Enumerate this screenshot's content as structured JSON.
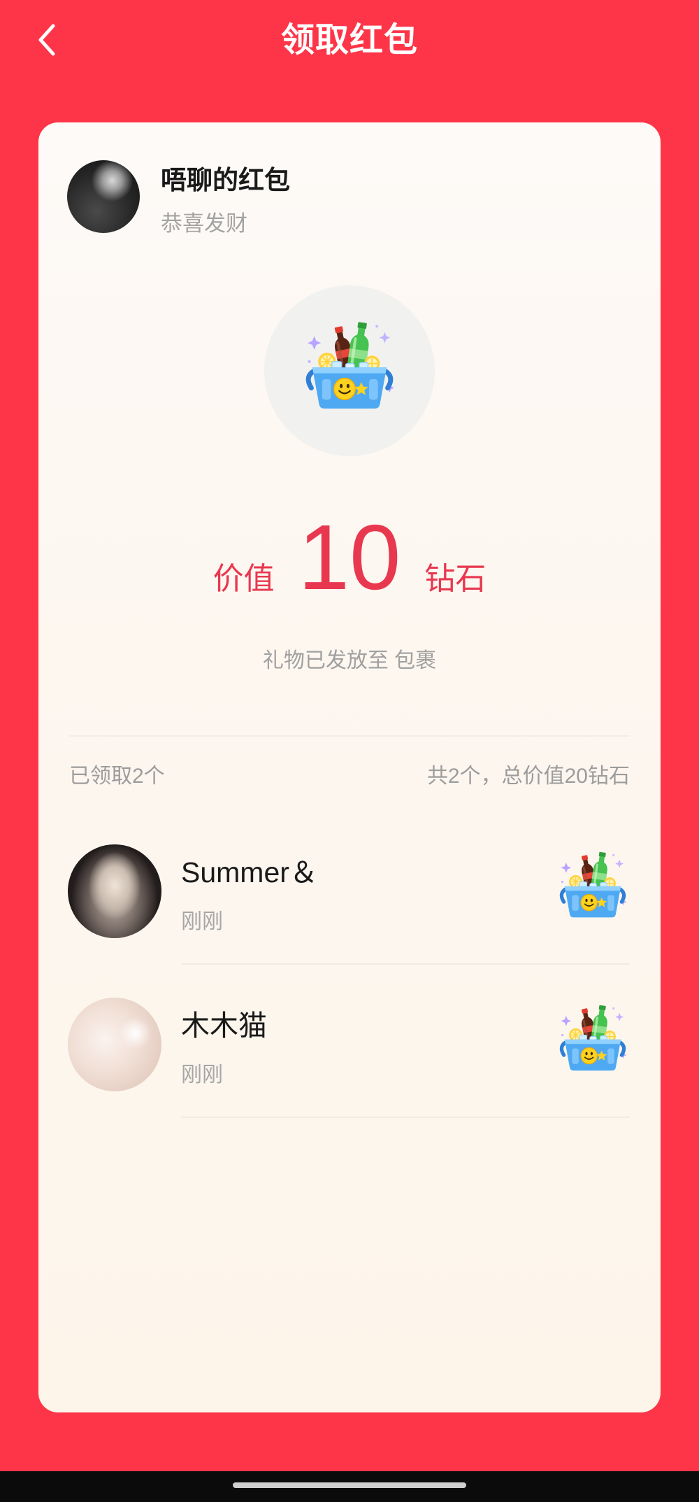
{
  "header": {
    "title": "领取红包"
  },
  "sender": {
    "name": "唔聊的红包",
    "greeting": "恭喜发财"
  },
  "value": {
    "prefix": "价值",
    "amount": "10",
    "unit": "钻石",
    "note": "礼物已发放至 包裹"
  },
  "summary": {
    "claimed": "已领取2个",
    "total": "共2个，总价值20钻石"
  },
  "recipients": [
    {
      "name": "Summer＆",
      "time": "刚刚"
    },
    {
      "name": "木木猫",
      "time": "刚刚"
    }
  ],
  "icons": {
    "back": "chevron-left-icon",
    "gift": "gift-basket-icon"
  },
  "colors": {
    "background": "#fe3548",
    "accent": "#e8384f",
    "card": "#fdf6ee",
    "secondary_text": "#a0a0a0",
    "nav_bar": "#0b0b0b"
  }
}
